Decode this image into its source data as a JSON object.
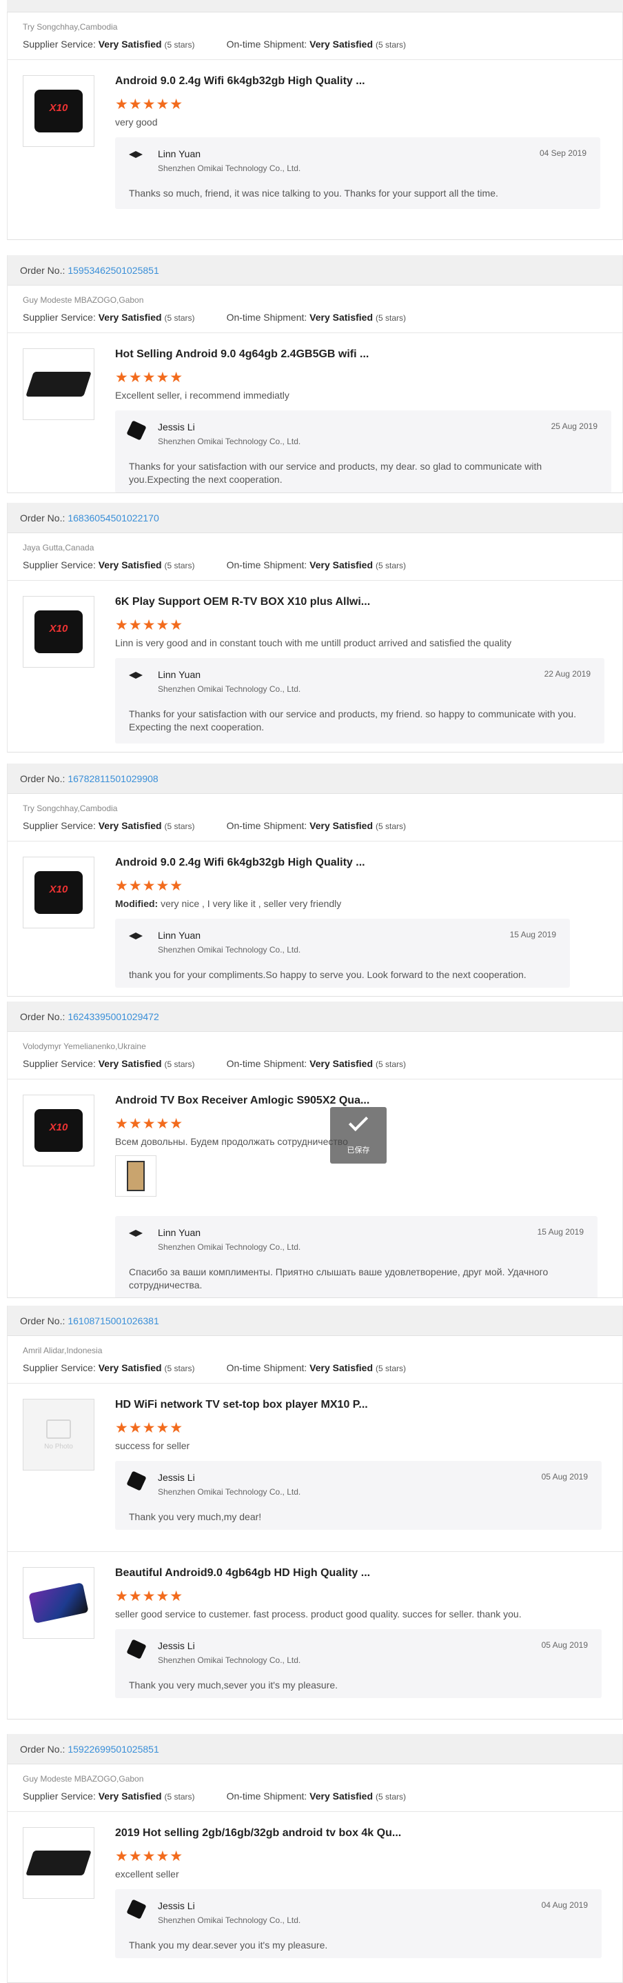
{
  "colors": {
    "accent_link": "#3a8fd8",
    "stars": "#f26b1d",
    "bar": "#f0f0f0"
  },
  "labels": {
    "order_no": "Order No.:",
    "supplier_service": "Supplier Service:",
    "ontime": "On-time Shipment:",
    "stars5": "(5 stars)",
    "very_satisfied": "Very Satisfied",
    "stars_glyph": "★★★★★",
    "modified": "Modified:"
  },
  "saved_toast": "已保存",
  "no_photo": "No Photo",
  "orders": [
    {
      "order_no": "",
      "customer": "Try Songchhay,Cambodia",
      "items": [
        {
          "title": "Android 9.0 2.4g Wifi 6k4gb32gb High Quality ...",
          "review": "very good",
          "reply": {
            "name": "Linn Yuan",
            "company": "Shenzhen Omikai Technology Co., Ltd.",
            "date": "04 Sep 2019",
            "message": "Thanks so much, friend, it was nice talking to you. Thanks for your support all the time."
          }
        }
      ]
    },
    {
      "order_no": "15953462501025851",
      "customer": "Guy Modeste MBAZOGO,Gabon",
      "items": [
        {
          "title": "Hot Selling Android 9.0 4g64gb 2.4GB5GB wifi ...",
          "review": "Excellent seller, i recommend immediatly",
          "reply": {
            "name": "Jessis Li",
            "company": "Shenzhen Omikai Technology Co., Ltd.",
            "date": "25 Aug 2019",
            "message": "Thanks for your satisfaction with our service and products, my dear. so glad to communicate with you.Expecting the next cooperation."
          }
        }
      ]
    },
    {
      "order_no": "16836054501022170",
      "customer": "Jaya Gutta,Canada",
      "items": [
        {
          "title": "6K Play Support OEM R-TV BOX X10 plus Allwi...",
          "review": "Linn is very good and in constant touch with me untill product arrived and satisfied the quality",
          "reply": {
            "name": "Linn Yuan",
            "company": "Shenzhen Omikai Technology Co., Ltd.",
            "date": "22 Aug 2019",
            "message": "Thanks for your satisfaction with our service and products, my friend. so happy to communicate with you. Expecting the next cooperation."
          }
        }
      ]
    },
    {
      "order_no": "16782811501029908",
      "customer": "Try Songchhay,Cambodia",
      "items": [
        {
          "title": "Android 9.0 2.4g Wifi 6k4gb32gb High Quality ...",
          "review": "very nice , I very like it , seller very friendly",
          "reply": {
            "name": "Linn Yuan",
            "company": "Shenzhen Omikai Technology Co., Ltd.",
            "date": "15 Aug 2019",
            "message": "thank you for your compliments.So happy to serve you.  Look forward  to the next cooperation."
          }
        }
      ]
    },
    {
      "order_no": "16243395001029472",
      "customer": "Volodymyr Yemelianenko,Ukraine",
      "items": [
        {
          "title": "Android TV Box Receiver Amlogic S905X2 Qua...",
          "review": "Всем довольны. Будем продолжать сотрудничество",
          "reply": {
            "name": "Linn Yuan",
            "company": "Shenzhen Omikai Technology Co., Ltd.",
            "date": "15 Aug 2019",
            "message": "Спасибо за ваши комплименты. Приятно слышать ваше удовлетворение, друг мой. Удачного сотрудничества."
          }
        }
      ]
    },
    {
      "order_no": "16108715001026381",
      "customer": "Amril Alidar,Indonesia",
      "items": [
        {
          "title": "HD WiFi network TV set-top box player MX10 P...",
          "review": "success for seller",
          "reply": {
            "name": "Jessis Li",
            "company": "Shenzhen Omikai Technology Co., Ltd.",
            "date": "05 Aug 2019",
            "message": "Thank you very much,my dear!"
          }
        },
        {
          "title": "Beautiful Android9.0 4gb64gb HD High Quality ...",
          "review": "seller good service to custemer. fast process. product good quality. succes for seller. thank you.",
          "reply": {
            "name": "Jessis Li",
            "company": "Shenzhen Omikai Technology Co., Ltd.",
            "date": "05 Aug 2019",
            "message": "Thank you very much,sever you it's my pleasure."
          }
        }
      ]
    },
    {
      "order_no": "15922699501025851",
      "customer": "Guy Modeste MBAZOGO,Gabon",
      "items": [
        {
          "title": "2019 Hot selling 2gb/16gb/32gb android tv box 4k Qu...",
          "review": "excellent seller",
          "reply": {
            "name": "Jessis Li",
            "company": "Shenzhen Omikai Technology Co., Ltd.",
            "date": "04 Aug 2019",
            "message": "Thank you my dear.sever you it's my pleasure."
          }
        }
      ]
    }
  ]
}
